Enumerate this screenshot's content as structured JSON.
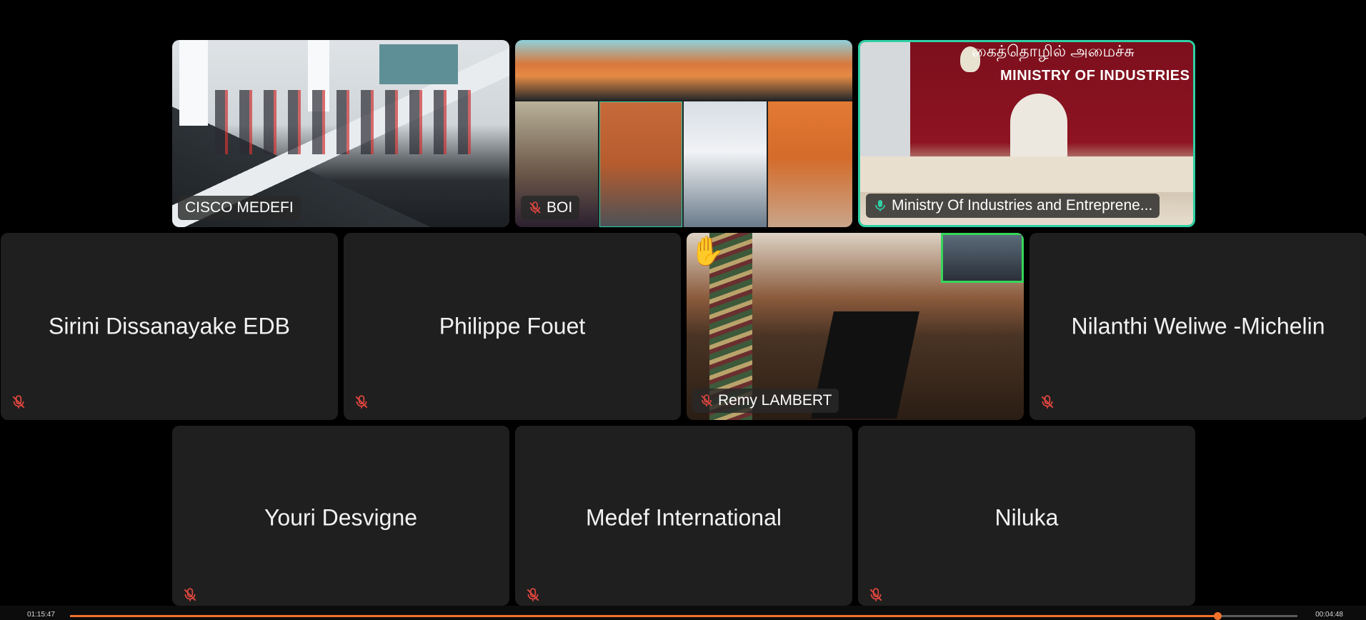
{
  "colors": {
    "speaking_border": "#2fd1a5",
    "tile_bg": "#1f1f1f",
    "muted_icon": "#e0463f",
    "progress": "#f2712a"
  },
  "tiles": {
    "cisco": {
      "name": "CISCO MEDEFI",
      "audio": "unmuted"
    },
    "boi": {
      "name": "BOI",
      "audio": "muted"
    },
    "ministry": {
      "name": "Ministry Of Industries and Entreprene...",
      "audio": "speaking",
      "sign_line1": "கைத்தொழில் அமைச்சு",
      "sign_line2": "MINISTRY OF INDUSTRIES"
    },
    "sirini": {
      "name": "Sirini Dissanayake EDB",
      "audio": "muted"
    },
    "philippe": {
      "name": "Philippe Fouet",
      "audio": "muted"
    },
    "remy": {
      "name": "Remy LAMBERT",
      "audio": "muted",
      "hand": "✋"
    },
    "nilanthi": {
      "name": "Nilanthi Weliwe -Michelin",
      "audio": "muted"
    },
    "youri": {
      "name": "Youri Desvigne",
      "audio": "muted"
    },
    "medef": {
      "name": "Medef International",
      "audio": "muted"
    },
    "niluka": {
      "name": "Niluka",
      "audio": "muted"
    }
  },
  "playback": {
    "elapsed": "01:15:47",
    "remaining": "00:04:48",
    "progress_fraction": 0.935
  }
}
